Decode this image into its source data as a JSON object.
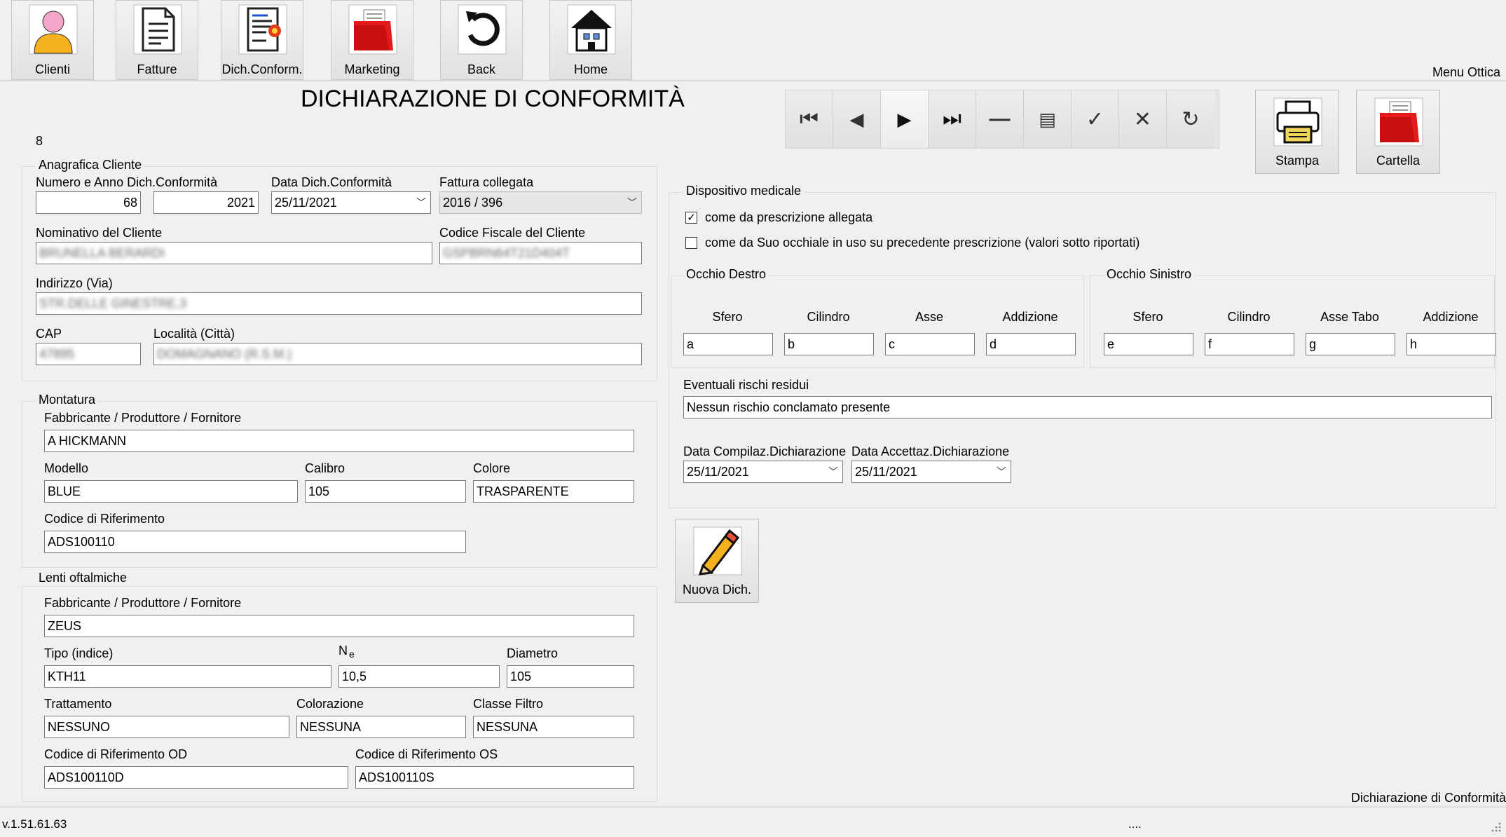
{
  "nav": [
    {
      "label": "Clienti",
      "icon": "person-icon"
    },
    {
      "label": "Fatture",
      "icon": "invoice-icon"
    },
    {
      "label": "Dich.Conform.",
      "icon": "declaration-icon"
    },
    {
      "label": "Marketing",
      "icon": "folder-icon"
    },
    {
      "label": "Back",
      "icon": "back-arrow-icon"
    },
    {
      "label": "Home",
      "icon": "home-icon"
    }
  ],
  "menu_label": "Menu Ottica",
  "page_title": "DICHIARAZIONE DI CONFORMITÀ",
  "record_id": "8",
  "toolbar": {
    "icons": [
      "first-record-icon",
      "previous-record-icon",
      "next-record-icon",
      "last-record-icon",
      "delete-record-icon",
      "new-record-icon",
      "confirm-icon",
      "cancel-icon",
      "refresh-icon"
    ]
  },
  "actions": {
    "print_label": "Stampa",
    "folder_label": "Cartella",
    "new_label": "Nuova Dich."
  },
  "anagrafica": {
    "title": "Anagrafica Cliente",
    "numero_label": "Numero e Anno  Dich.Conformità",
    "numero_value": "68",
    "anno_value": "2021",
    "data_label": "Data  Dich.Conformità",
    "data_value": "25/11/2021",
    "fattura_label": "Fattura collegata",
    "fattura_value": "2016 / 396",
    "nominativo_label": "Nominativo del Cliente",
    "nominativo_value": "BRUNELLA BERARDI",
    "cf_label": "Codice Fiscale del Cliente",
    "cf_value": "GSPBRN64T21D404T",
    "indirizzo_label": "Indirizzo (Via)",
    "indirizzo_value": "STR.DELLE GINESTRE,3",
    "cap_label": "CAP",
    "cap_value": "47895",
    "localita_label": "Località (Città)",
    "localita_value": "DOMAGNANO (R.S.M.)"
  },
  "montatura": {
    "title": "Montatura",
    "fabbricante_label": "Fabbricante / Produttore / Fornitore",
    "fabbricante_value": "A HICKMANN",
    "modello_label": "Modello",
    "modello_value": "BLUE",
    "calibro_label": "Calibro",
    "calibro_value": "105",
    "colore_label": "Colore",
    "colore_value": "TRASPARENTE",
    "codice_label": "Codice di Riferimento",
    "codice_value": "ADS100110"
  },
  "lenti": {
    "title": "Lenti oftalmiche",
    "fabbricante_label": "Fabbricante / Produttore / Fornitore",
    "fabbricante_value": "ZEUS",
    "tipo_label": "Tipo (indice)",
    "tipo_value": "KTH11",
    "ne_label": "N",
    "ne_sub": "e",
    "ne_value": "10,5",
    "diametro_label": "Diametro",
    "diametro_value": "105",
    "trattamento_label": "Trattamento",
    "trattamento_value": "NESSUNO",
    "colorazione_label": "Colorazione",
    "colorazione_value": "NESSUNA",
    "filtro_label": "Classe Filtro",
    "filtro_value": "NESSUNA",
    "od_label": "Codice di Riferimento OD",
    "od_value": "ADS100110D",
    "os_label": "Codice di Riferimento OS",
    "os_value": "ADS100110S"
  },
  "dispositivo": {
    "title": "Dispositivo medicale",
    "option1": "come da prescrizione allegata",
    "option1_checked": true,
    "option2": "come da Suo occhiale in uso su precedente prescrizione (valori sotto riportati)",
    "option2_checked": false,
    "od_title": "Occhio Destro",
    "os_title": "Occhio Sinistro",
    "od_cols": [
      "Sfero",
      "Cilindro",
      "Asse",
      "Addizione"
    ],
    "od_vals": [
      "a",
      "b",
      "c",
      "d"
    ],
    "os_cols": [
      "Sfero",
      "Cilindro",
      "Asse Tabo",
      "Addizione"
    ],
    "os_vals": [
      "e",
      "f",
      "g",
      "h"
    ],
    "rischi_label": "Eventuali rischi residui",
    "rischi_value": "Nessun rischio conclamato presente",
    "compilaz_label": "Data Compilaz.Dichiarazione",
    "compilaz_value": "25/11/2021",
    "accettaz_label": "Data Accettaz.Dichiarazione",
    "accettaz_value": "25/11/2021"
  },
  "footer": {
    "version": "v.1.51.61.63",
    "dots": "....",
    "page_name": "Dichiarazione di Conformità"
  }
}
